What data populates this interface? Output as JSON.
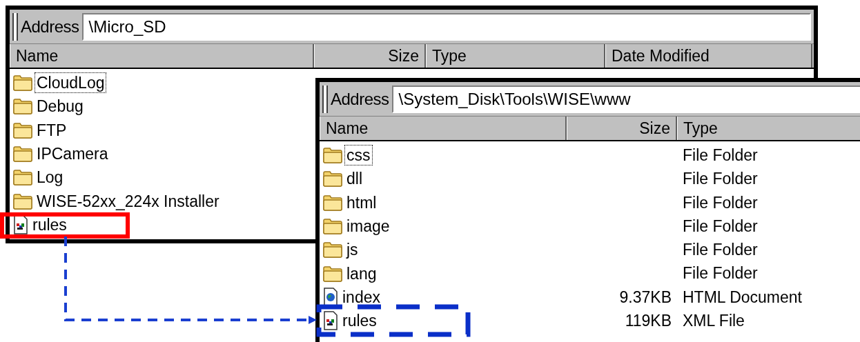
{
  "windows": [
    {
      "address_label": "Address",
      "address": "\\Micro_SD",
      "columns": [
        "Name",
        "Size",
        "Type",
        "Date Modified"
      ],
      "rows": [
        {
          "name": "CloudLog",
          "kind": "folder",
          "focused": true
        },
        {
          "name": "Debug",
          "kind": "folder",
          "focused": false
        },
        {
          "name": "FTP",
          "kind": "folder",
          "focused": false
        },
        {
          "name": "IPCamera",
          "kind": "folder",
          "focused": false
        },
        {
          "name": "Log",
          "kind": "folder",
          "focused": false
        },
        {
          "name": "WISE-52xx_224x Installer",
          "kind": "folder",
          "focused": false
        },
        {
          "name": "rules",
          "kind": "xml",
          "focused": false
        }
      ]
    },
    {
      "address_label": "Address",
      "address": "\\System_Disk\\Tools\\WISE\\www",
      "columns": [
        "Name",
        "Size",
        "Type"
      ],
      "rows": [
        {
          "name": "css",
          "kind": "folder",
          "focused": true,
          "type": "File Folder"
        },
        {
          "name": "dll",
          "kind": "folder",
          "focused": false,
          "type": "File Folder"
        },
        {
          "name": "html",
          "kind": "folder",
          "focused": false,
          "type": "File Folder"
        },
        {
          "name": "image",
          "kind": "folder",
          "focused": false,
          "type": "File Folder"
        },
        {
          "name": "js",
          "kind": "folder",
          "focused": false,
          "type": "File Folder"
        },
        {
          "name": "lang",
          "kind": "folder",
          "focused": false,
          "type": "File Folder"
        },
        {
          "name": "index",
          "kind": "html",
          "focused": false,
          "size": "9.37KB",
          "type": "HTML Document"
        },
        {
          "name": "rules",
          "kind": "xml",
          "focused": false,
          "size": "119KB",
          "type": "XML File"
        }
      ]
    }
  ]
}
